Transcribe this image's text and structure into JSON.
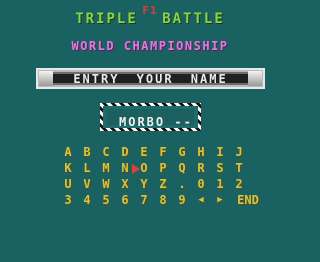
{
  "logo": {
    "f1": "F1",
    "title": "TRIPLE BATTLE",
    "subtitle": "WORLD CHAMPIONSHIP"
  },
  "banner": {
    "label": "ENTRY YOUR NAME"
  },
  "name_entry": {
    "value": "MORBO --"
  },
  "keyboard": {
    "rows": [
      [
        "A",
        "B",
        "C",
        "D",
        "E",
        "F",
        "G",
        "H",
        "I",
        "J"
      ],
      [
        "K",
        "L",
        "M",
        "N",
        "O",
        "P",
        "Q",
        "R",
        "S",
        "T"
      ],
      [
        "U",
        "V",
        "W",
        "X",
        "Y",
        "Z",
        ".",
        "0",
        "1",
        "2"
      ],
      [
        "3",
        "4",
        "5",
        "6",
        "7",
        "8",
        "9",
        "◀",
        "▶",
        "END"
      ]
    ],
    "cursor_on": "O"
  },
  "colors": {
    "background": "#1a6262",
    "logo_red": "#e23a3a",
    "logo_green": "#8ad24a",
    "logo_magenta": "#e079e0",
    "keyboard_yellow": "#d8c341",
    "cursor_red": "#e53b3b"
  }
}
